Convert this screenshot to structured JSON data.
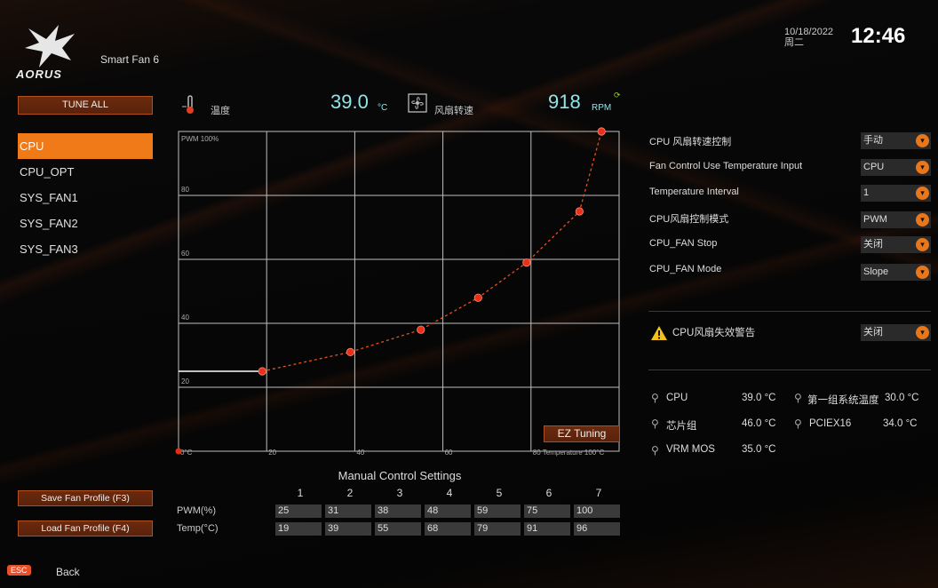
{
  "header": {
    "logo_text": "AORUS",
    "app_title": "Smart Fan 6",
    "date": "10/18/2022",
    "weekday": "周二",
    "time": "12:46"
  },
  "nav": {
    "tune_all_label": "TUNE ALL",
    "fans": [
      "CPU",
      "CPU_OPT",
      "SYS_FAN1",
      "SYS_FAN2",
      "SYS_FAN3"
    ],
    "selected_fan": "CPU",
    "save_profile_label": "Save Fan Profile (F3)",
    "load_profile_label": "Load Fan Profile (F4)",
    "esc_key": "ESC",
    "back_label": "Back"
  },
  "readouts": {
    "temp_label": "温度",
    "temp_value": "39.0",
    "temp_unit": "°C",
    "fan_label": "风扇转速",
    "rpm_value": "918",
    "rpm_unit": "RPM",
    "refresh_icon": "refresh-icon"
  },
  "chart_data": {
    "type": "line",
    "title": "",
    "y_axis_label": "PWM 100%",
    "y_ticks": [
      "80",
      "60",
      "40",
      "20"
    ],
    "x_ticks": [
      "0°C",
      "20",
      "40",
      "60",
      "80 Temperature 100°C"
    ],
    "xlim": [
      0,
      100
    ],
    "ylim": [
      0,
      100
    ],
    "series": [
      {
        "color": "#e8501c",
        "x": [
          19,
          39,
          55,
          68,
          79,
          91,
          96
        ],
        "values": [
          25,
          31,
          38,
          48,
          59,
          75,
          100
        ]
      }
    ],
    "grid": true
  },
  "ez_tuning_label": "EZ Tuning",
  "manual": {
    "title": "Manual Control Settings",
    "points": [
      "1",
      "2",
      "3",
      "4",
      "5",
      "6",
      "7"
    ],
    "pwm_label": "PWM(%)",
    "temp_label": "Temp(°C)",
    "pwm": [
      "25",
      "31",
      "38",
      "48",
      "59",
      "75",
      "100"
    ],
    "temp": [
      "19",
      "39",
      "55",
      "68",
      "79",
      "91",
      "96"
    ]
  },
  "settings": [
    {
      "label": "CPU 风扇转速控制",
      "value": "手动"
    },
    {
      "label": "Fan Control Use Temperature Input",
      "value": "CPU"
    },
    {
      "label": "Temperature Interval",
      "value": "1"
    },
    {
      "label": "CPU风扇控制模式",
      "value": "PWM"
    },
    {
      "label": "CPU_FAN Stop",
      "value": "关闭"
    },
    {
      "label": "CPU_FAN Mode",
      "value": "Slope"
    }
  ],
  "warning": {
    "label": "CPU风扇失效警告",
    "value": "关闭"
  },
  "sensors": [
    {
      "label": "CPU",
      "value": "39.0 °C",
      "icon": "thermometer-icon"
    },
    {
      "label": "第一组系统温度",
      "value": "30.0 °C",
      "icon": "thermometer-icon"
    },
    {
      "label": "芯片组",
      "value": "46.0 °C",
      "icon": "thermometer-icon"
    },
    {
      "label": "PCIEX16",
      "value": "34.0 °C",
      "icon": "thermometer-icon"
    },
    {
      "label": "VRM MOS",
      "value": "35.0 °C",
      "icon": "thermometer-icon"
    }
  ],
  "colors": {
    "accent": "#f07a18",
    "value_cyan": "#8fe6e8",
    "curve": "#e8501c"
  }
}
